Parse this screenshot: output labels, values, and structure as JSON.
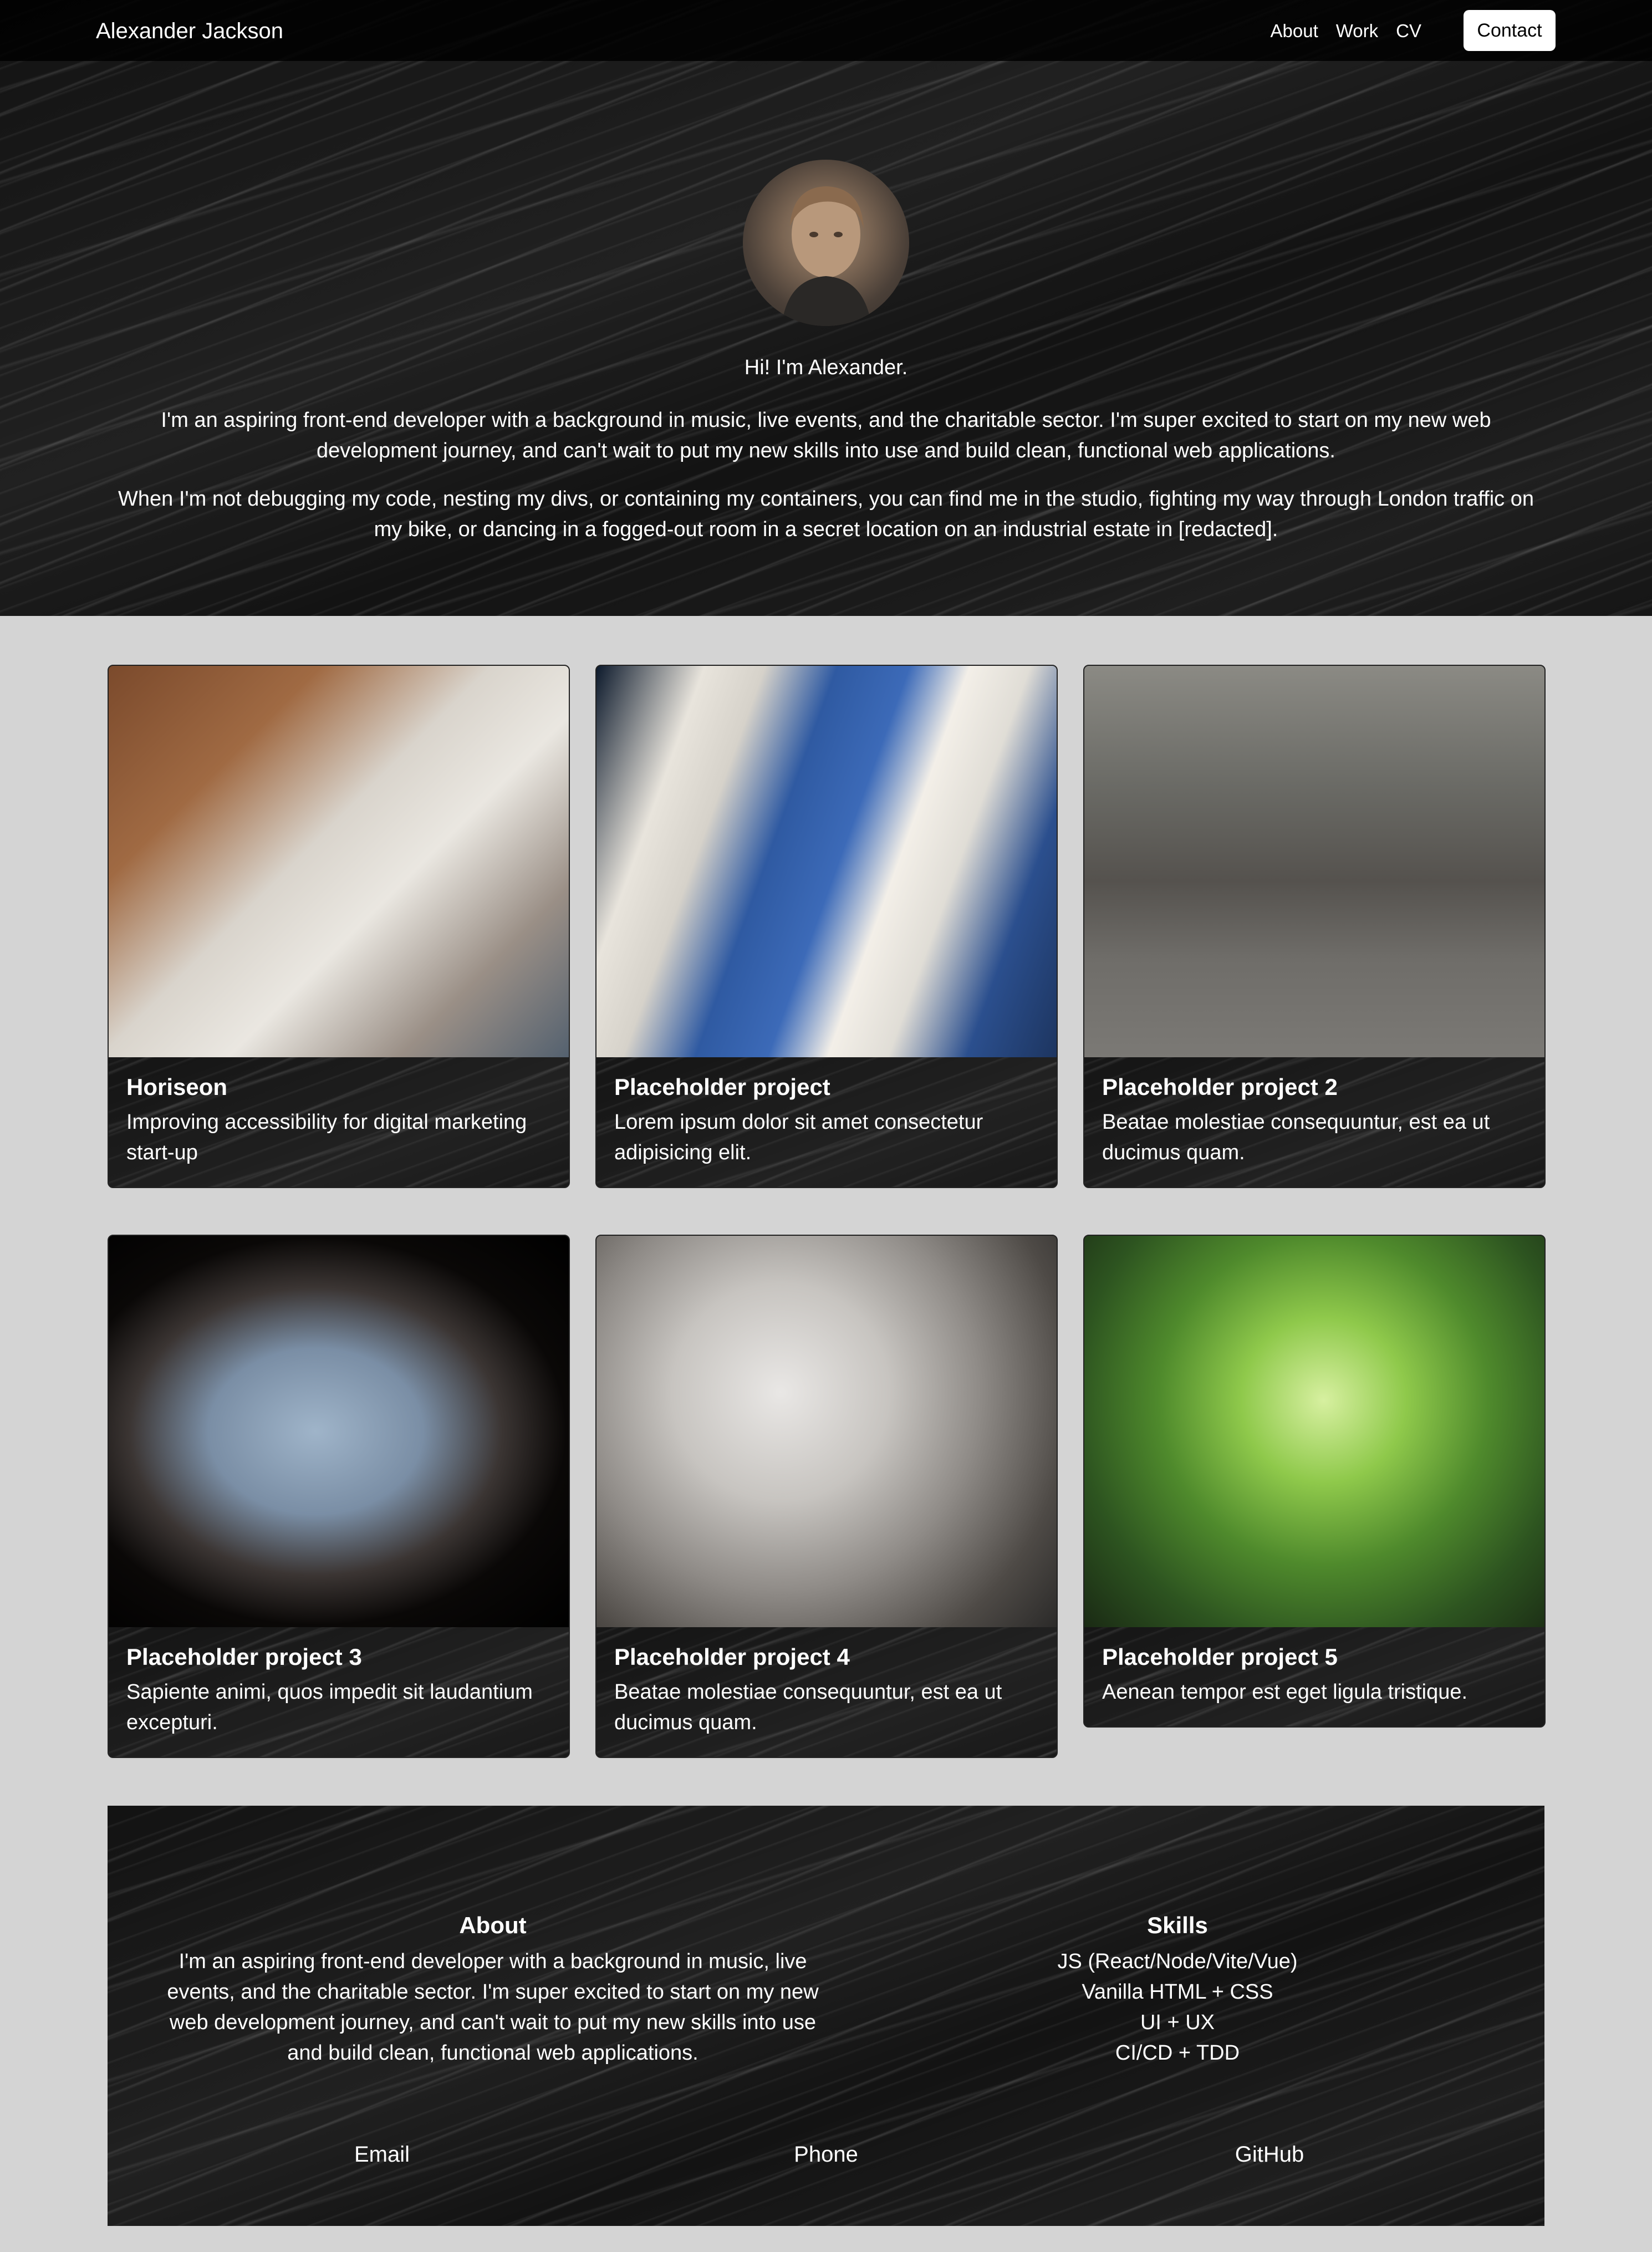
{
  "nav": {
    "brand": "Alexander Jackson",
    "links": [
      "About",
      "Work",
      "CV"
    ],
    "contact_label": "Contact"
  },
  "hero": {
    "greeting": "Hi! I'm Alexander.",
    "paragraph1": "I'm an aspiring front-end developer with a background in music, live events, and the charitable sector. I'm super excited to start on my new web development journey, and can't wait to put my new skills into use and build clean, functional web applications.",
    "paragraph2": "When I'm not debugging my code, nesting my divs, or containing my containers, you can find me in the studio, fighting my way through London traffic on my bike, or dancing in a fogged-out room in a secret location on an industrial estate in [redacted]."
  },
  "projects": [
    {
      "title": "Horiseon",
      "description": "Improving accessibility for digital marketing start-up",
      "image": "team-meeting-photo"
    },
    {
      "title": "Placeholder project",
      "description": "Lorem ipsum dolor sit amet consectetur adipisicing elit.",
      "image": "building-facade-photo"
    },
    {
      "title": "Placeholder project 2",
      "description": "Beatae molestiae consequuntur, est ea ut ducimus quam.",
      "image": "city-cyclist-photo"
    },
    {
      "title": "Placeholder project 3",
      "description": "Sapiente animi, quos impedit sit laudantium excepturi.",
      "image": "bridge-window-photo"
    },
    {
      "title": "Placeholder project 4",
      "description": "Beatae molestiae consequuntur, est ea ut ducimus quam.",
      "image": "falcon-closeup-photo"
    },
    {
      "title": "Placeholder project 5",
      "description": "Aenean tempor est eget ligula tristique.",
      "image": "forest-canopy-photo"
    }
  ],
  "footer": {
    "about_heading": "About",
    "about_text": "I'm an aspiring front-end developer with a background in music, live events, and the charitable sector. I'm super excited to start on my new web development journey, and can't wait to put my new skills into use and build clean, functional web applications.",
    "skills_heading": "Skills",
    "skills": [
      "JS (React/Node/Vite/Vue)",
      "Vanilla HTML + CSS",
      "UI + UX",
      "CI/CD + TDD"
    ],
    "links": {
      "email": "Email",
      "phone": "Phone",
      "github": "GitHub"
    }
  },
  "colors": {
    "page_background": "#d4d4d4",
    "dark_surface": "#0e0e0e",
    "text": "#ffffff",
    "contact_button_bg": "#ffffff"
  }
}
